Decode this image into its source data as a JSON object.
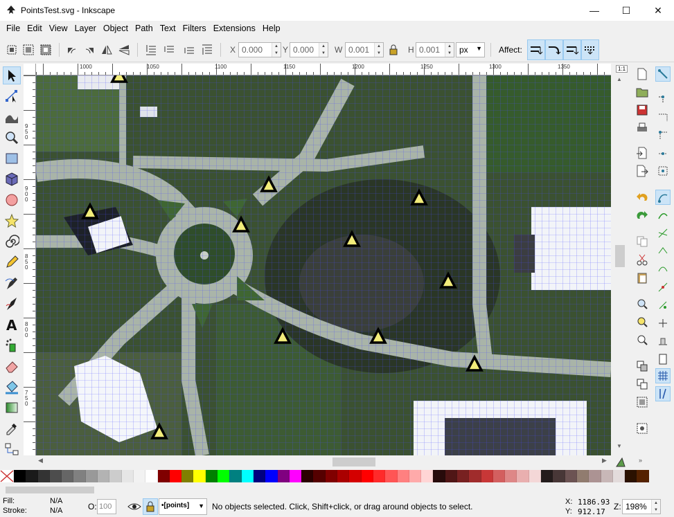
{
  "window": {
    "title": "PointsTest.svg - Inkscape",
    "minimize": "—",
    "maximize": "☐",
    "close": "✕"
  },
  "menu": [
    "File",
    "Edit",
    "View",
    "Layer",
    "Object",
    "Path",
    "Text",
    "Filters",
    "Extensions",
    "Help"
  ],
  "toolbar": {
    "x_label": "X",
    "x_value": "0.000",
    "y_label": "Y",
    "y_value": "0.000",
    "w_label": "W",
    "w_value": "0.001",
    "h_label": "H",
    "h_value": "0.001",
    "unit": "px",
    "affect_label": "Affect:"
  },
  "ruler": {
    "top": [
      "1000",
      "1050",
      "1100",
      "1150",
      "1200",
      "1250",
      "1300",
      "1350"
    ],
    "left": [
      "950",
      "900",
      "850",
      "800",
      "750"
    ]
  },
  "status": {
    "fill_label": "Fill:",
    "fill_value": "N/A",
    "stroke_label": "Stroke:",
    "stroke_value": "N/A",
    "opacity_label": "O:",
    "opacity_value": "100",
    "layer": "•[points]",
    "message": "No objects selected. Click, Shift+click, or drag around objects to select.",
    "x_label": "X:",
    "x_value": "1186.93",
    "y_label": "Y:",
    "y_value": "912.17",
    "zoom_label": "Z:",
    "zoom_value": "198%"
  },
  "colors": {
    "accent": "#cce4f7",
    "accent_border": "#99c9ef",
    "marker_fill": "#f2ec7a",
    "grid": "#3333ff"
  },
  "palette": [
    "#000000",
    "#1a1a1a",
    "#333333",
    "#4d4d4d",
    "#666666",
    "#808080",
    "#999999",
    "#b3b3b3",
    "#cccccc",
    "#e6e6e6",
    "#f2f2f2",
    "#ffffff",
    "#800000",
    "#ff0000",
    "#808000",
    "#ffff00",
    "#008000",
    "#00ff00",
    "#008080",
    "#00ffff",
    "#000080",
    "#0000ff",
    "#800080",
    "#ff00ff",
    "#2b0000",
    "#550000",
    "#800000",
    "#aa0000",
    "#d40000",
    "#ff0000",
    "#ff2a2a",
    "#ff5555",
    "#ff8080",
    "#ffaaaa",
    "#ffd5d5",
    "#280b0b",
    "#501616",
    "#782121",
    "#a02c2c",
    "#c83737",
    "#d35f5f",
    "#de8787",
    "#e9afaf",
    "#f4d7d7",
    "#241c1c",
    "#483737",
    "#6c5353",
    "#917c6f",
    "#ac9393",
    "#c8b7b7",
    "#e3dbdb",
    "#2b1100",
    "#552200"
  ],
  "icons": {
    "tools": [
      "selector-tool-icon",
      "node-tool-icon",
      "tweak-tool-icon",
      "zoom-tool-icon",
      "rect-tool-icon",
      "3dbox-tool-icon",
      "ellipse-tool-icon",
      "star-tool-icon",
      "spiral-tool-icon",
      "pencil-tool-icon",
      "pen-tool-icon",
      "calligraphy-tool-icon",
      "text-tool-icon",
      "spray-tool-icon",
      "eraser-tool-icon",
      "bucket-tool-icon",
      "gradient-tool-icon",
      "dropper-tool-icon",
      "connector-tool-icon"
    ]
  }
}
